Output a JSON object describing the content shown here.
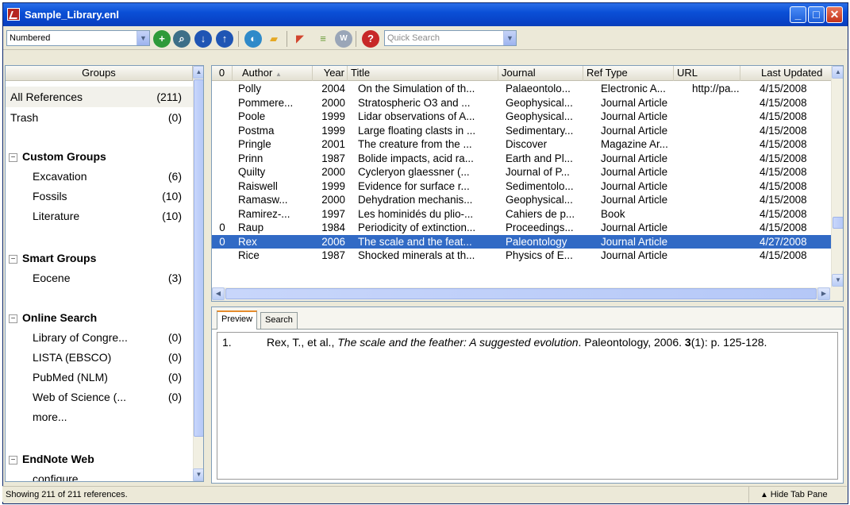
{
  "window": {
    "title": "Sample_Library.enl",
    "minimize": "_",
    "maximize": "□",
    "close": "✕"
  },
  "toolbar": {
    "style_value": "Numbered",
    "quick_search_placeholder": "Quick Search",
    "icons": [
      "new-reference-icon",
      "online-search-icon",
      "import-icon",
      "export-icon",
      "connect-icon",
      "open-file-icon",
      "pdf-icon",
      "format-bibliography-icon",
      "word-icon",
      "help-icon"
    ]
  },
  "groups": {
    "header": "Groups",
    "all_references": {
      "label": "All References",
      "count": "(211)"
    },
    "trash": {
      "label": "Trash",
      "count": "(0)"
    },
    "custom": {
      "heading": "Custom Groups",
      "items": [
        {
          "label": "Excavation",
          "count": "(6)"
        },
        {
          "label": "Fossils",
          "count": "(10)"
        },
        {
          "label": "Literature",
          "count": "(10)"
        }
      ]
    },
    "smart": {
      "heading": "Smart Groups",
      "items": [
        {
          "label": "Eocene",
          "count": "(3)"
        }
      ]
    },
    "online": {
      "heading": "Online Search",
      "items": [
        {
          "label": "Library of Congre...",
          "count": "(0)"
        },
        {
          "label": "LISTA (EBSCO)",
          "count": "(0)"
        },
        {
          "label": "PubMed (NLM)",
          "count": "(0)"
        },
        {
          "label": "Web of Science (...",
          "count": "(0)"
        },
        {
          "label": "more...",
          "count": ""
        }
      ]
    },
    "endnote_web": {
      "heading": "EndNote Web",
      "items": [
        {
          "label": "configure...",
          "count": ""
        }
      ]
    }
  },
  "table": {
    "columns": [
      "Author",
      "Year",
      "Title",
      "Journal",
      "Ref Type",
      "URL",
      "Last Updated"
    ],
    "attachment_header": "0",
    "sort_indicator": "▲",
    "rows": [
      {
        "attach": "",
        "author": "Polly",
        "year": "2004",
        "title": "On the Simulation of th...",
        "journal": "Palaeontolo...",
        "reftype": "Electronic A...",
        "url": "http://pa...",
        "updated": "4/15/2008"
      },
      {
        "attach": "",
        "author": "Pommere...",
        "year": "2000",
        "title": "Stratospheric O3 and ...",
        "journal": "Geophysical...",
        "reftype": "Journal Article",
        "url": "",
        "updated": "4/15/2008"
      },
      {
        "attach": "",
        "author": "Poole",
        "year": "1999",
        "title": "Lidar observations of A...",
        "journal": "Geophysical...",
        "reftype": "Journal Article",
        "url": "",
        "updated": "4/15/2008"
      },
      {
        "attach": "",
        "author": "Postma",
        "year": "1999",
        "title": "Large floating clasts in ...",
        "journal": "Sedimentary...",
        "reftype": "Journal Article",
        "url": "",
        "updated": "4/15/2008"
      },
      {
        "attach": "",
        "author": "Pringle",
        "year": "2001",
        "title": "The creature from the ...",
        "journal": "Discover",
        "reftype": "Magazine Ar...",
        "url": "",
        "updated": "4/15/2008"
      },
      {
        "attach": "",
        "author": "Prinn",
        "year": "1987",
        "title": "Bolide impacts, acid ra...",
        "journal": "Earth and Pl...",
        "reftype": "Journal Article",
        "url": "",
        "updated": "4/15/2008"
      },
      {
        "attach": "",
        "author": "Quilty",
        "year": "2000",
        "title": "Cycleryon glaessner (...",
        "journal": "Journal of P...",
        "reftype": "Journal Article",
        "url": "",
        "updated": "4/15/2008"
      },
      {
        "attach": "",
        "author": "Raiswell",
        "year": "1999",
        "title": "Evidence for surface r...",
        "journal": "Sedimentolo...",
        "reftype": "Journal Article",
        "url": "",
        "updated": "4/15/2008"
      },
      {
        "attach": "",
        "author": "Ramasw...",
        "year": "2000",
        "title": "Dehydration mechanis...",
        "journal": "Geophysical...",
        "reftype": "Journal Article",
        "url": "",
        "updated": "4/15/2008"
      },
      {
        "attach": "",
        "author": "Ramirez-...",
        "year": "1997",
        "title": "Les hominidés du plio-...",
        "journal": "Cahiers de p...",
        "reftype": "Book",
        "url": "",
        "updated": "4/15/2008"
      },
      {
        "attach": "0",
        "author": "Raup",
        "year": "1984",
        "title": "Periodicity of extinction...",
        "journal": "Proceedings...",
        "reftype": "Journal Article",
        "url": "",
        "updated": "4/15/2008"
      },
      {
        "attach": "0",
        "author": "Rex",
        "year": "2006",
        "title": "The scale and the feat...",
        "journal": "Paleontology",
        "reftype": "Journal Article",
        "url": "",
        "updated": "4/27/2008",
        "selected": true
      },
      {
        "attach": "",
        "author": "Rice",
        "year": "1987",
        "title": "Shocked minerals at th...",
        "journal": "Physics of E...",
        "reftype": "Journal Article",
        "url": "",
        "updated": "4/15/2008"
      }
    ]
  },
  "tabs": {
    "preview": "Preview",
    "search": "Search"
  },
  "preview": {
    "number": "1.",
    "authors": "Rex, T., et al., ",
    "title": "The scale and the feather: A suggested evolution",
    "journal_year": ". Paleontology, 2006. ",
    "volume": "3",
    "issue_pages": "(1): p. 125-128."
  },
  "status": {
    "text": "Showing 211 of 211 references.",
    "hide_tab_pane": "Hide Tab Pane"
  }
}
